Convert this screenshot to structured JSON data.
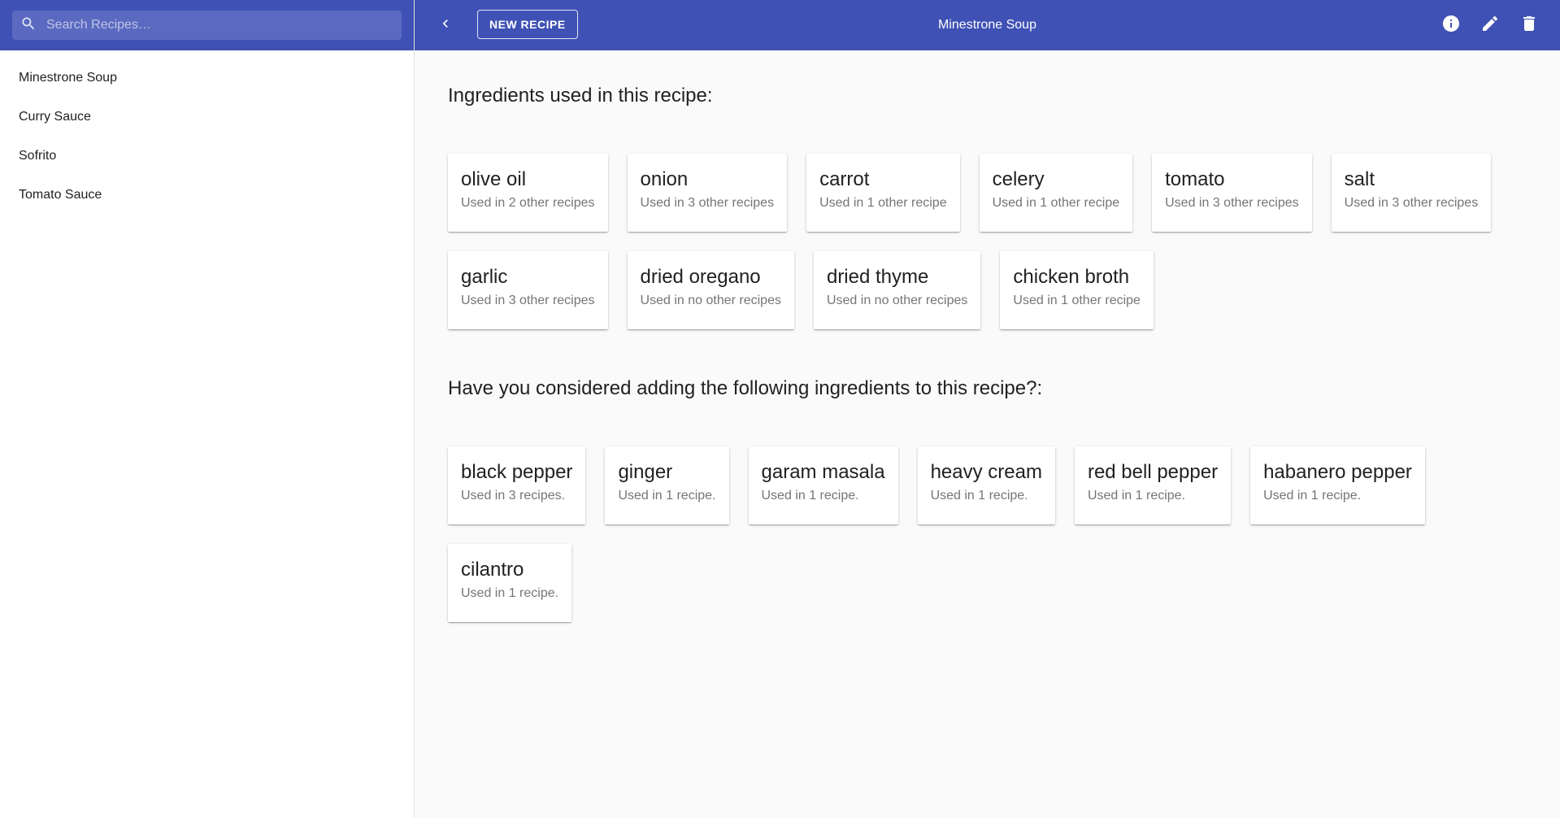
{
  "search": {
    "placeholder": "Search Recipes…"
  },
  "sidebar": {
    "recipes": [
      {
        "label": "Minestrone Soup"
      },
      {
        "label": "Curry Sauce"
      },
      {
        "label": "Sofrito"
      },
      {
        "label": "Tomato Sauce"
      }
    ]
  },
  "toolbar": {
    "new_recipe_label": "NEW RECIPE",
    "title": "Minestrone Soup",
    "icons": [
      "back-chevron-icon",
      "info-icon",
      "edit-icon",
      "delete-icon"
    ]
  },
  "main": {
    "used_heading": "Ingredients used in this recipe:",
    "used_ingredients": [
      {
        "name": "olive oil",
        "usage": "Used in 2 other recipes"
      },
      {
        "name": "onion",
        "usage": "Used in 3 other recipes"
      },
      {
        "name": "carrot",
        "usage": "Used in 1 other recipe"
      },
      {
        "name": "celery",
        "usage": "Used in 1 other recipe"
      },
      {
        "name": "tomato",
        "usage": "Used in 3 other recipes"
      },
      {
        "name": "salt",
        "usage": "Used in 3 other recipes"
      },
      {
        "name": "garlic",
        "usage": "Used in 3 other recipes"
      },
      {
        "name": "dried oregano",
        "usage": "Used in no other recipes"
      },
      {
        "name": "dried thyme",
        "usage": "Used in no other recipes"
      },
      {
        "name": "chicken broth",
        "usage": "Used in 1 other recipe"
      }
    ],
    "suggested_heading": "Have you considered adding the following ingredients to this recipe?:",
    "suggested_ingredients": [
      {
        "name": "black pepper",
        "usage": "Used in 3 recipes."
      },
      {
        "name": "ginger",
        "usage": "Used in 1 recipe."
      },
      {
        "name": "garam masala",
        "usage": "Used in 1 recipe."
      },
      {
        "name": "heavy cream",
        "usage": "Used in 1 recipe."
      },
      {
        "name": "red bell pepper",
        "usage": "Used in 1 recipe."
      },
      {
        "name": "habanero pepper",
        "usage": "Used in 1 recipe."
      },
      {
        "name": "cilantro",
        "usage": "Used in 1 recipe."
      }
    ]
  },
  "colors": {
    "primary": "#3f51b5",
    "background": "#fafafa"
  }
}
